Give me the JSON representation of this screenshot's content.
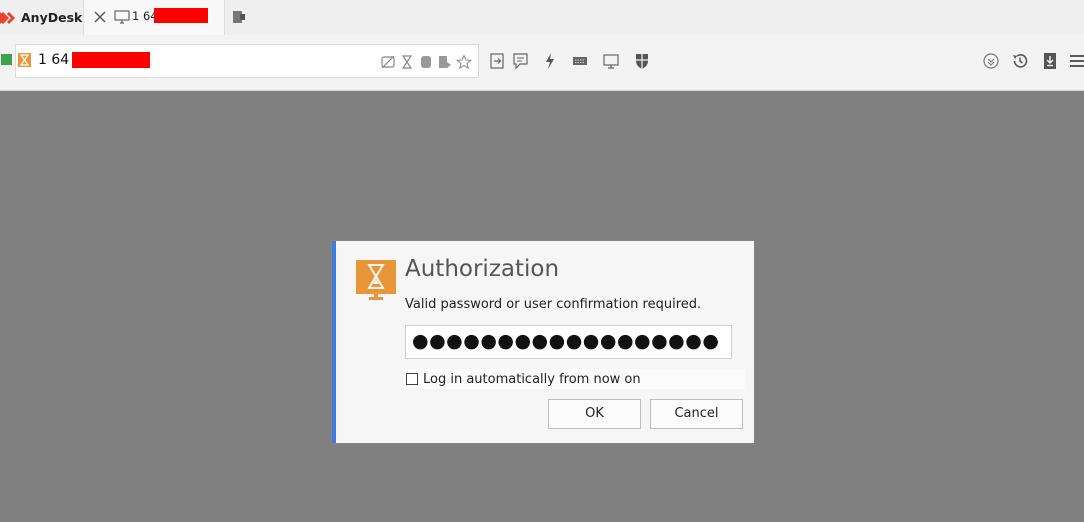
{
  "app": {
    "name": "AnyDesk",
    "brand_color": "#e8412c"
  },
  "tab": {
    "label": "1 64",
    "icon": "monitor-icon",
    "close_icon": "close-icon"
  },
  "toolbar": {
    "address_value": "1 64",
    "address_icons": [
      "no-record-icon",
      "hourglass-icon",
      "keyboard-lock-icon",
      "paste-icon",
      "star-icon"
    ],
    "tools": [
      "file-transfer-icon",
      "chat-icon",
      "actions-icon",
      "keyboard-icon",
      "display-icon",
      "permissions-icon"
    ],
    "right_tools": [
      "download-icon",
      "history-icon",
      "install-icon",
      "menu-icon"
    ]
  },
  "dialog": {
    "title": "Authorization",
    "subtitle": "Valid password or user confirmation required.",
    "password_value": "●●●●●●●●●●●●●●●●●●",
    "autologin_label": "Log in automatically from now on",
    "autologin_checked": false,
    "ok_label": "OK",
    "cancel_label": "Cancel",
    "accent_color": "#e9953a"
  }
}
